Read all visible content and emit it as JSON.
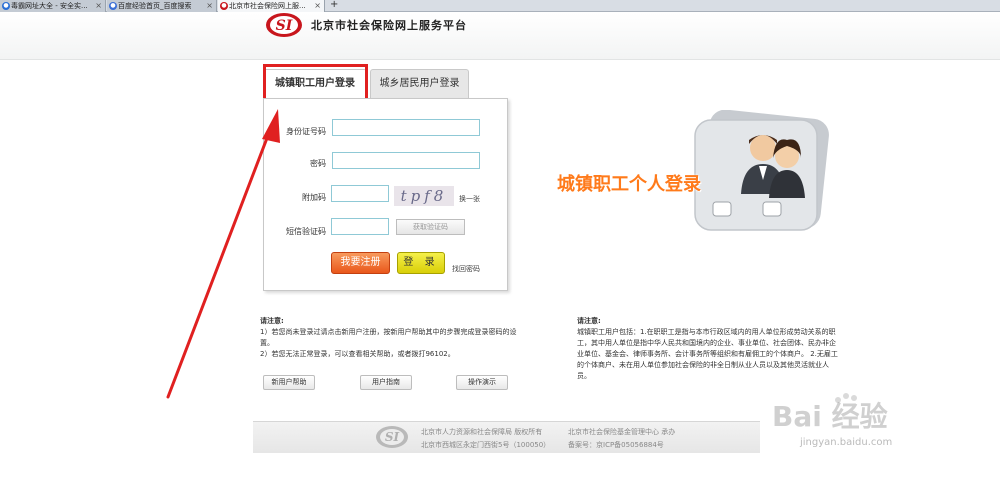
{
  "browser": {
    "tabs": [
      {
        "label": "毒霸网址大全 - 安全实...",
        "active": false
      },
      {
        "label": "百度经验首页_百度搜索",
        "active": false
      },
      {
        "label": "北京市社会保险网上服...",
        "active": true
      }
    ],
    "new_tab": "+"
  },
  "site": {
    "title": "北京市社会保险网上服务平台"
  },
  "login": {
    "tabs": [
      "城镇职工用户登录",
      "城乡居民用户登录"
    ],
    "id_label": "身份证号码",
    "password_label": "密码",
    "captcha_label": "附加码",
    "captcha_text": "tpf8",
    "captcha_refresh": "换一张",
    "sms_label": "短信验证码",
    "sms_button": "获取验证码",
    "register_button": "我要注册",
    "login_button": "登 录",
    "forgot_link": "找回密码"
  },
  "illustration": {
    "title": "城镇职工个人登录"
  },
  "notes_left": {
    "heading": "请注意:",
    "line1": "1）若您尚未登录过请点击新用户注册，按新用户帮助其中的步骤完成登录密码的设",
    "line1b": "置。",
    "line2": "2）若您无法正常登录，可以查看相关帮助，或者拨打96102。",
    "buttons": [
      "新用户帮助",
      "用户指南",
      "操作演示"
    ]
  },
  "notes_right": {
    "heading": "请注意:",
    "lines": [
      "城镇职工用户包括：1.在职职工是指与本市行政区域内的用人单位形成劳动关系的职",
      "工，其中用人单位是指中华人民共和国境内的企业、事业单位、社会团体、民办非企",
      "业单位、基金会、律师事务所、会计事务所等组织和有雇佣工的个体商户。 2.无雇工",
      "的个体商户、未在用人单位参加社会保险的非全日制从业人员以及其他灵活就业人",
      "员。"
    ]
  },
  "footer": {
    "line1_left": "北京市人力资源和社会保障局  版权所有",
    "line1_right": "北京市社会保险基金管理中心  承办",
    "line2_left": "北京市西城区永定门西街5号（100050）",
    "line2_right": "备案号：京ICP备05056884号"
  },
  "watermark": {
    "text": "Bai 经验",
    "sub": "jingyan.baidu.com"
  },
  "colors": {
    "highlight": "#e02020",
    "register": "#e9571b",
    "login": "#e6dc10",
    "brand_red": "#c8161d",
    "illustration_orange": "#ff7a1a"
  }
}
